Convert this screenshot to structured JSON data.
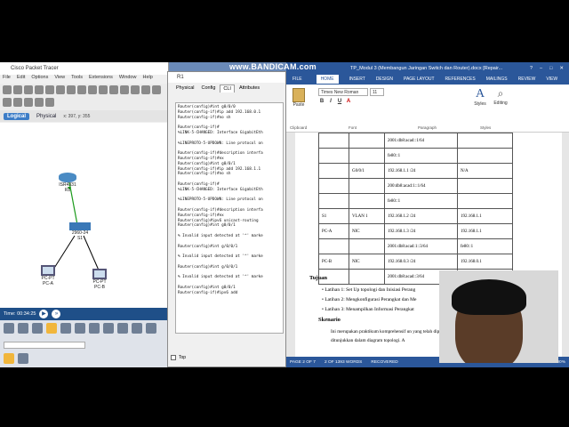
{
  "watermark": "www.BANDICAM.com",
  "packet_tracer": {
    "title": "Cisco Packet Tracer",
    "menu": [
      "File",
      "Edit",
      "Options",
      "View",
      "Tools",
      "Extensions",
      "Window",
      "Help"
    ],
    "tab_logical": "Logical",
    "tab_physical": "Physical",
    "coords": "x: 397, y: 355",
    "devices": {
      "router": {
        "label1": "ISR4331",
        "label2": "R1"
      },
      "switch": {
        "label1": "2960-24",
        "label2": "S1"
      },
      "pc_a": {
        "label1": "PC-PT",
        "label2": "PC-A"
      },
      "pc_b": {
        "label1": "PC-PT",
        "label2": "PC-B"
      }
    },
    "time": "Time: 00:34:25"
  },
  "r1_window": {
    "title": "R1",
    "tabs": [
      "Physical",
      "Config",
      "CLI",
      "Attributes"
    ],
    "cli_text": "Router(config)#int g0/0/0\nRouter(config-if)#ip add 192.168.0.1\nRouter(config-if)#no sh\n\nRouter(config-if)#\n%LINK-5-CHANGED: Interface GigabitEth\n\n%LINEPROTO-5-UPDOWN: Line protocol on\n\nRouter(config-if)#description interfa\nRouter(config-if)#ex\nRouter(config)#int g0/0/1\nRouter(config-if)#ip add 192.168.1.1\nRouter(config-if)#no sh\n\nRouter(config-if)#\n%LINK-5-CHANGED: Interface GigabitEth\n\n%LINEPROTO-5-UPDOWN: Line protocol on\n\nRouter(config-if)#description interfa\nRouter(config-if)#ex\nRouter(config)#ipv6 unicast-routing\nRouter(config)#int g0/0/1\n\n% Invalid input detected at '^' marke\n\nRouter(config)#int g/0/0/1\n\n% Invalid input detected at '^' marke\n\nRouter(config)#int g/0/0/1\n\n% Invalid input detected at '^' marke\n\nRouter(config)#int g0/0/1\nRouter(config-if)#ipv6 add",
    "top_label": "Top"
  },
  "word": {
    "title": "TP_Modul 3 (Membangun Jaringan Switch dan Router).docx [Repair...",
    "tabs": [
      "FILE",
      "HOME",
      "INSERT",
      "DESIGN",
      "PAGE LAYOUT",
      "REFERENCES",
      "MAILINGS",
      "REVIEW",
      "VIEW"
    ],
    "font_name": "Times New Roman",
    "font_size": "11",
    "paste_label": "Paste",
    "styles_label": "Styles",
    "editing_label": "Editing",
    "groups": [
      "Clipboard",
      "Font",
      "Paragraph",
      "Styles"
    ],
    "table_rows": [
      [
        "",
        "",
        "2001:db8:acad::1/64",
        ""
      ],
      [
        "",
        "",
        "fe80::1",
        ""
      ],
      [
        "",
        "G0/0/1",
        "192.168.1.1 /24",
        "N/A"
      ],
      [
        "",
        "",
        "200:db8:acad:1::1/64",
        ""
      ],
      [
        "",
        "",
        "fe80::1",
        ""
      ],
      [
        "S1",
        "VLAN 1",
        "192.168.1.2 /24",
        "192.168.1.1"
      ],
      [
        "PC-A",
        "NIC",
        "192.168.1.3 /24",
        "192.168.1.1"
      ],
      [
        "",
        "",
        "2001:db8:acad:1::3/64",
        "fe80::1"
      ],
      [
        "PC-B",
        "NIC",
        "192.168.0.3 /24",
        "192.168.0.1"
      ],
      [
        "",
        "",
        "2001:db8:acad::3/64",
        "fe80::1"
      ]
    ],
    "tujuan": "Tujuan",
    "bullets": [
      "Latihan 1: Set Up topologi dan Inisiasi Perang",
      "Latihan 2: Mengkonfigurasi Perangkat dan Me",
      "Latihan 3: Menampilkan Informasi Perangkat"
    ],
    "skenario": "Skenario",
    "paragraph": "Ini merupakan praktikum komprehensif un yang telah dipelajari sebelumnya. Dalam praktikum in sebagaimana ditunjukkan dalam diagram topologi. A",
    "status": [
      "PAGE 2 OF 7",
      "2 OF 1393 WORDS",
      "RECOVERED"
    ],
    "zoom": "100%"
  }
}
